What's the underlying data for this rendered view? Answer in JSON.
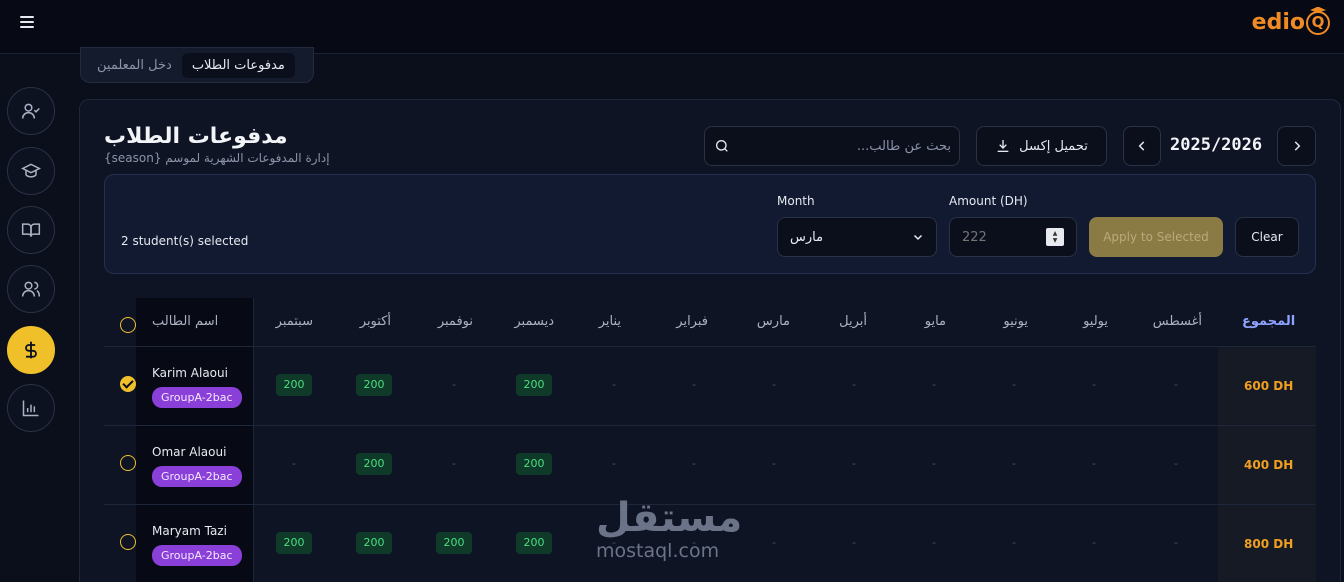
{
  "brand": {
    "logo": "edioQ"
  },
  "tabs": [
    {
      "label": "مدفوعات الطلاب"
    },
    {
      "label": "دخل المعلمين"
    }
  ],
  "page": {
    "title": "مدفوعات الطلاب",
    "subtitle": "إدارة المدفوعات الشهرية لموسم {season}"
  },
  "toolbar": {
    "search_placeholder": "بحث عن طالب...",
    "export_label": "تحميل إكسل",
    "season": "2025/2026"
  },
  "bulk": {
    "selected_count": "2 student(s) selected",
    "month_label": "Month",
    "month_value": "مارس",
    "amount_label": "Amount (DH)",
    "amount_placeholder": "222",
    "apply_label": "Apply to Selected",
    "clear_label": "Clear"
  },
  "table": {
    "name_header": "اسم الطالب",
    "total_header": "المجموع",
    "months": [
      "سبتمبر",
      "أكتوبر",
      "نوفمبر",
      "ديسمبر",
      "يناير",
      "فبراير",
      "مارس",
      "أبريل",
      "مايو",
      "يونيو",
      "يوليو",
      "أغسطس"
    ],
    "rows": [
      {
        "name": "Karim Alaoui",
        "group": "GroupA-2bac",
        "selected": true,
        "cells": [
          "200",
          "200",
          "-",
          "200",
          "-",
          "-",
          "-",
          "-",
          "-",
          "-",
          "-",
          "-"
        ],
        "total": "600 DH"
      },
      {
        "name": "Omar Alaoui",
        "group": "GroupA-2bac",
        "selected": false,
        "cells": [
          "-",
          "200",
          "-",
          "200",
          "-",
          "-",
          "-",
          "-",
          "-",
          "-",
          "-",
          "-"
        ],
        "total": "400 DH"
      },
      {
        "name": "Maryam Tazi",
        "group": "GroupA-2bac",
        "selected": false,
        "cells": [
          "200",
          "200",
          "200",
          "200",
          "-",
          "-",
          "-",
          "-",
          "-",
          "-",
          "-",
          "-"
        ],
        "total": "800 DH"
      }
    ]
  },
  "watermark": {
    "arabic": "مستقل",
    "latin": "mostaql.com"
  },
  "colors": {
    "accent": "#f0c02a",
    "paid_bg": "#0f3a2a",
    "paid_text": "#4ade80",
    "badge": "#8b3fd9",
    "total": "#f0a020"
  }
}
